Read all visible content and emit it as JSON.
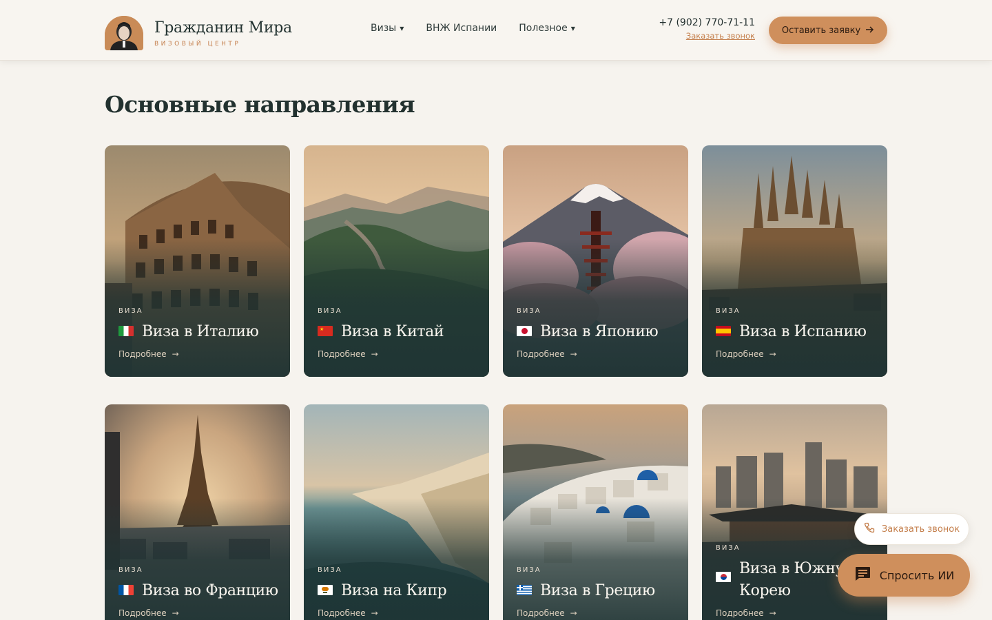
{
  "header": {
    "logo_title": "Гражданин Мира",
    "logo_subtitle": "визовый центр",
    "nav": [
      {
        "label": "Визы",
        "has_dropdown": true
      },
      {
        "label": "ВНЖ Испании",
        "has_dropdown": false
      },
      {
        "label": "Полезное",
        "has_dropdown": true
      }
    ],
    "phone": "+7 (902) 770-71-11",
    "callback_link": "Заказать звонок",
    "cta_label": "Оставить заявку"
  },
  "section": {
    "title": "Основные направления"
  },
  "cards": [
    {
      "kicker": "ВИЗА",
      "title": "Виза в Италию",
      "more": "Подробнее",
      "flag": "italy-flag",
      "scene": "colosseum"
    },
    {
      "kicker": "ВИЗА",
      "title": "Виза в Китай",
      "more": "Подробнее",
      "flag": "china-flag",
      "scene": "great-wall"
    },
    {
      "kicker": "ВИЗА",
      "title": "Виза в Японию",
      "more": "Подробнее",
      "flag": "japan-flag",
      "scene": "fuji-pagoda"
    },
    {
      "kicker": "ВИЗА",
      "title": "Виза в Испанию",
      "more": "Подробнее",
      "flag": "spain-flag",
      "scene": "sagrada-familia"
    },
    {
      "kicker": "ВИЗА",
      "title": "Виза во Францию",
      "more": "Подробнее",
      "flag": "france-flag",
      "scene": "eiffel-tower"
    },
    {
      "kicker": "ВИЗА",
      "title": "Виза на Кипр",
      "more": "Подробнее",
      "flag": "cyprus-flag",
      "scene": "coast-cliffs"
    },
    {
      "kicker": "ВИЗА",
      "title": "Виза в Грецию",
      "more": "Подробнее",
      "flag": "greece-flag",
      "scene": "santorini"
    },
    {
      "kicker": "ВИЗА",
      "title": "Виза в Южну Корею",
      "more": "Подробнее",
      "flag": "korea-flag",
      "scene": "seoul-skyline"
    }
  ],
  "floating": {
    "callback_label": "Заказать звонок",
    "ai_label": "Спросить ИИ"
  },
  "colors": {
    "accent": "#cf8f5c",
    "accent_text": "#c47f4c",
    "card_dark": "#1f3434",
    "background": "#f6f3ee"
  }
}
